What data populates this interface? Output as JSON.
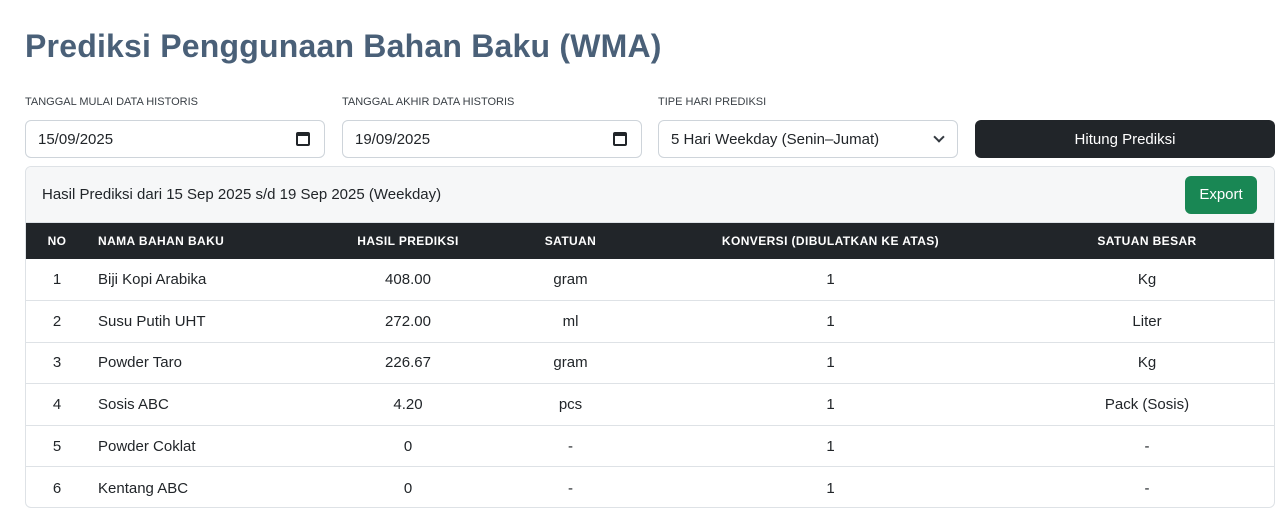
{
  "page": {
    "title": "Prediksi Penggunaan Bahan Baku (WMA)"
  },
  "filters": {
    "start_label": "TANGGAL MULAI DATA HISTORIS",
    "start_value": "15/09/2025",
    "end_label": "TANGGAL AKHIR DATA HISTORIS",
    "end_value": "19/09/2025",
    "type_label": "TIPE HARI PREDIKSI",
    "type_value": "5 Hari Weekday (Senin–Jumat)",
    "submit_label": "Hitung Prediksi"
  },
  "result": {
    "header_text": "Hasil Prediksi dari 15 Sep 2025 s/d 19 Sep 2025 (Weekday)",
    "export_label": "Export",
    "columns": {
      "no": "NO",
      "name": "NAMA BAHAN BAKU",
      "prediction": "HASIL PREDIKSI",
      "unit": "SATUAN",
      "conversion": "KONVERSI (DIBULATKAN KE ATAS)",
      "big_unit": "SATUAN BESAR"
    },
    "rows": [
      {
        "no": "1",
        "name": "Biji Kopi Arabika",
        "prediction": "408.00",
        "unit": "gram",
        "conversion": "1",
        "big_unit": "Kg"
      },
      {
        "no": "2",
        "name": "Susu Putih UHT",
        "prediction": "272.00",
        "unit": "ml",
        "conversion": "1",
        "big_unit": "Liter"
      },
      {
        "no": "3",
        "name": "Powder Taro",
        "prediction": "226.67",
        "unit": "gram",
        "conversion": "1",
        "big_unit": "Kg"
      },
      {
        "no": "4",
        "name": "Sosis ABC",
        "prediction": "4.20",
        "unit": "pcs",
        "conversion": "1",
        "big_unit": "Pack (Sosis)"
      },
      {
        "no": "5",
        "name": "Powder Coklat",
        "prediction": "0",
        "unit": "-",
        "conversion": "1",
        "big_unit": "-"
      },
      {
        "no": "6",
        "name": "Kentang ABC",
        "prediction": "0",
        "unit": "-",
        "conversion": "1",
        "big_unit": "-"
      }
    ]
  },
  "colors": {
    "title": "#4a6078",
    "dark": "#212529",
    "export": "#198754"
  },
  "icons": {
    "date": "calendar-icon",
    "select": "chevron-down-icon"
  }
}
